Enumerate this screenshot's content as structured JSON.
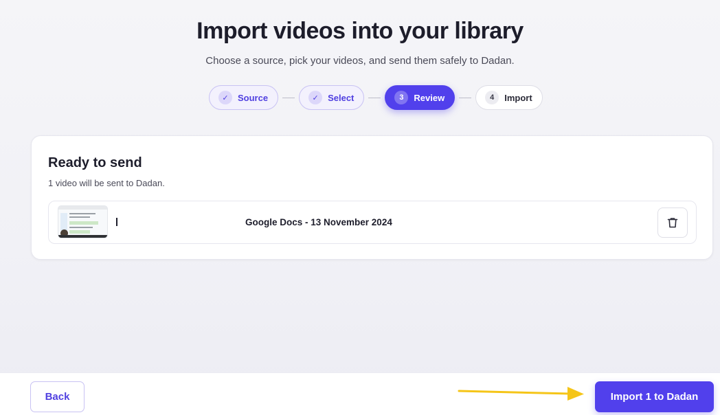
{
  "header": {
    "title": "Import videos into your library",
    "subtitle": "Choose a source, pick your videos, and send them safely to Dadan."
  },
  "stepper": {
    "steps": [
      {
        "label": "Source",
        "badge": "✓",
        "state": "done"
      },
      {
        "label": "Select",
        "badge": "✓",
        "state": "done"
      },
      {
        "label": "Review",
        "badge": "3",
        "state": "active"
      },
      {
        "label": "Import",
        "badge": "4",
        "state": "pending"
      }
    ]
  },
  "review": {
    "title": "Ready to send",
    "summary": "1 video will be sent to Dadan.",
    "videos": [
      {
        "name": "Google Docs - 13 November 2024",
        "delete_icon": "trash-icon"
      }
    ]
  },
  "footer": {
    "back_label": "Back",
    "import_label": "Import 1 to Dadan"
  },
  "colors": {
    "accent": "#5140ec",
    "annotation_arrow": "#f5c518"
  }
}
